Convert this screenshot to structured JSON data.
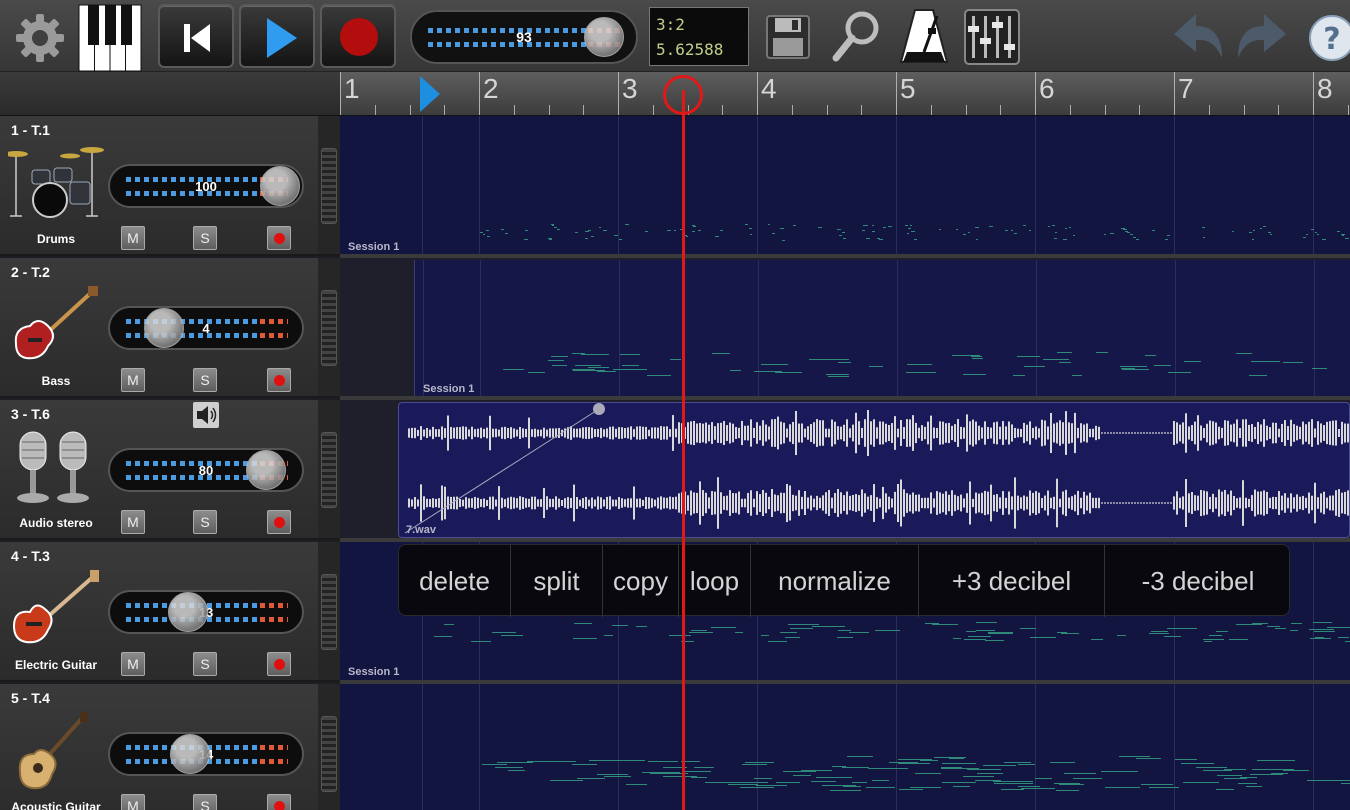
{
  "toolbar": {
    "tempo": "93",
    "position_bar_beat": "3:2",
    "position_seconds": "5.62588"
  },
  "ruler": {
    "bars": [
      "1",
      "2",
      "3",
      "4",
      "5",
      "6",
      "7",
      "8"
    ]
  },
  "tracks": [
    {
      "id": "1 - T.1",
      "instrument": "Drums",
      "volume": "100",
      "session": "Session 1"
    },
    {
      "id": "2 - T.2",
      "instrument": "Bass",
      "volume": "4",
      "session": "Session 1"
    },
    {
      "id": "3 - T.6",
      "instrument": "Audio stereo",
      "volume": "80",
      "session": "7.wav"
    },
    {
      "id": "4 - T.3",
      "instrument": "Electric Guitar",
      "volume": "13",
      "session": "Session 1"
    },
    {
      "id": "5 - T.4",
      "instrument": "Acoustic Guitar",
      "volume": "14",
      "session": ""
    }
  ],
  "track_buttons": {
    "mute": "M",
    "solo": "S"
  },
  "context_menu": [
    "delete",
    "split",
    "copy",
    "loop",
    "normalize",
    "+3 decibel",
    "-3 decibel"
  ],
  "icons": {
    "settings": "gear-icon",
    "piano": "piano-icon",
    "rewind": "skip-back-icon",
    "play": "play-icon",
    "record": "record-icon",
    "save": "floppy-icon",
    "zoom": "magnifier-icon",
    "metronome": "metronome-icon",
    "mixer": "mixer-icon",
    "undo": "undo-icon",
    "redo": "redo-icon",
    "help": "help-icon"
  },
  "colors": {
    "playhead": "#e01818",
    "lane": "#121540",
    "accent": "#1d8ee0"
  }
}
